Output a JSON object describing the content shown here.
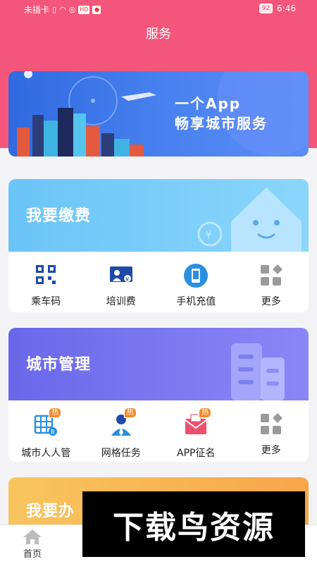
{
  "status_bar": {
    "carrier": "未插卡",
    "badge": "HD",
    "battery": "92",
    "time": "6:46"
  },
  "page_title": "服务",
  "banner": {
    "slogan_line1": "一个App",
    "slogan_line2": "畅享城市服务"
  },
  "payment": {
    "title": "我要缴费",
    "items": [
      {
        "label": "乘车码",
        "icon": "qr-code-icon"
      },
      {
        "label": "培训费",
        "icon": "training-board-icon"
      },
      {
        "label": "手机充值",
        "icon": "mobile-phone-icon"
      },
      {
        "label": "更多",
        "icon": "more-grid-icon"
      }
    ]
  },
  "city": {
    "title": "城市管理",
    "hot_label": "热",
    "items": [
      {
        "label": "城市人人管",
        "icon": "building-icon",
        "hot": true
      },
      {
        "label": "网格任务",
        "icon": "person-icon",
        "hot": true
      },
      {
        "label": "APP征名",
        "icon": "envelope-icon",
        "hot": true
      },
      {
        "label": "更多",
        "icon": "more-grid-icon",
        "hot": false
      }
    ]
  },
  "partial_card": {
    "title": "我要办"
  },
  "tabbar": {
    "home_label": "首页"
  },
  "watermark": "下载鸟资源",
  "colors": {
    "header_pink": "#f4557a",
    "banner_blue": "#3a74e8",
    "payment_blue": "#6bc4f7",
    "city_purple": "#6a68ea",
    "partial_orange": "#f8c55e"
  }
}
